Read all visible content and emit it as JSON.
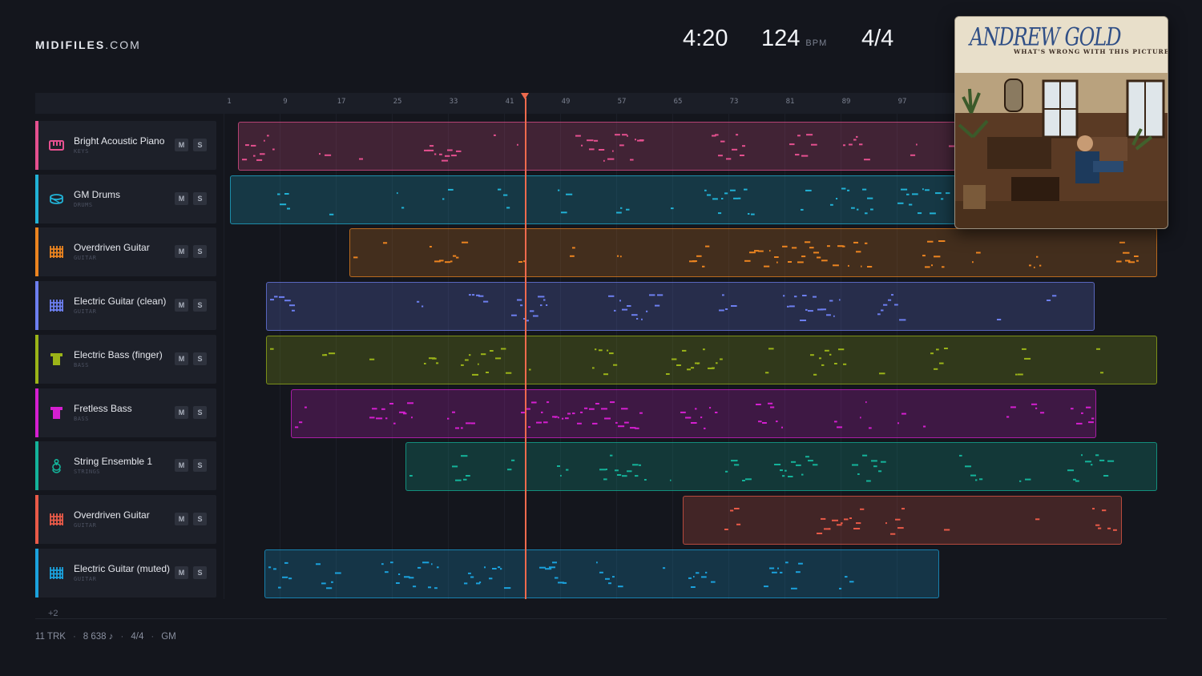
{
  "app": {
    "logo_bold": "MIDIFILES",
    "logo_domain": ".COM"
  },
  "transport": {
    "time": "4:20",
    "tempo": "124",
    "tempo_unit": "BPM",
    "time_signature": "4/4"
  },
  "ruler": {
    "bar_ticks": [
      "1",
      "9",
      "17",
      "25",
      "33",
      "41",
      "49",
      "57",
      "65",
      "73",
      "81",
      "89",
      "97"
    ]
  },
  "playhead": {
    "bar": 43
  },
  "tracks": [
    {
      "name": "Bright Acoustic Piano",
      "category": "KEYS",
      "icon": "piano-icon",
      "color": "#e5508f",
      "mute": "M",
      "solo": "S",
      "clip_span": [
        2,
        999
      ]
    },
    {
      "name": "GM Drums",
      "category": "DRUMS",
      "icon": "drum-icon",
      "color": "#21b2d6",
      "mute": "M",
      "solo": "S",
      "clip_span": [
        1,
        999
      ]
    },
    {
      "name": "Overdriven Guitar",
      "category": "GUITAR",
      "icon": "guitar-grid-icon",
      "color": "#ec8420",
      "mute": "M",
      "solo": "S",
      "clip_span": [
        17,
        999
      ]
    },
    {
      "name": "Electric Guitar (clean)",
      "category": "GUITAR",
      "icon": "guitar-grid-icon",
      "color": "#6d7ff0",
      "mute": "M",
      "solo": "S",
      "clip_span": [
        6,
        999
      ]
    },
    {
      "name": "Electric Bass (finger)",
      "category": "BASS",
      "icon": "bass-icon",
      "color": "#9bb418",
      "mute": "M",
      "solo": "S",
      "clip_span": [
        6,
        999
      ]
    },
    {
      "name": "Fretless Bass",
      "category": "BASS",
      "icon": "bass-icon",
      "color": "#d51fd0",
      "mute": "M",
      "solo": "S",
      "clip_span": [
        10,
        999
      ]
    },
    {
      "name": "String Ensemble 1",
      "category": "STRINGS",
      "icon": "strings-icon",
      "color": "#14b39a",
      "mute": "M",
      "solo": "S",
      "clip_span": [
        26,
        999
      ]
    },
    {
      "name": "Overdriven Guitar",
      "category": "GUITAR",
      "icon": "guitar-grid-icon",
      "color": "#e95a48",
      "mute": "M",
      "solo": "S",
      "clip_span": [
        64,
        999
      ]
    },
    {
      "name": "Electric Guitar (muted)",
      "category": "GUITAR",
      "icon": "guitar-grid-icon",
      "color": "#1ba2dd",
      "mute": "M",
      "solo": "S",
      "clip_span": [
        6,
        999
      ]
    }
  ],
  "more_tracks": "+2",
  "footer": {
    "tracks": "11 TRK",
    "notes": "8 638 ♪",
    "time_signature": "4/4",
    "standard": "GM",
    "separator": "·"
  },
  "cover": {
    "artist": "ANDREW GOLD",
    "title": "WHAT'S WRONG WITH THIS PICTURE?"
  }
}
